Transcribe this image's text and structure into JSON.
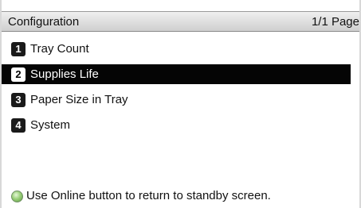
{
  "header": {
    "title": "Configuration",
    "page_indicator": "1/1 Page"
  },
  "menu": {
    "selected_index": 1,
    "items": [
      {
        "number": "1",
        "label": "Tray Count"
      },
      {
        "number": "2",
        "label": "Supplies Life"
      },
      {
        "number": "3",
        "label": "Paper Size in Tray"
      },
      {
        "number": "4",
        "label": "System"
      }
    ]
  },
  "footer": {
    "icon": "online-button-icon",
    "message": "Use Online button to return to standby screen."
  },
  "colors": {
    "selected_background": "#050505",
    "selected_text": "#ffffff",
    "header_background": "#d8d8d8",
    "online_icon": "#8cc36a"
  }
}
